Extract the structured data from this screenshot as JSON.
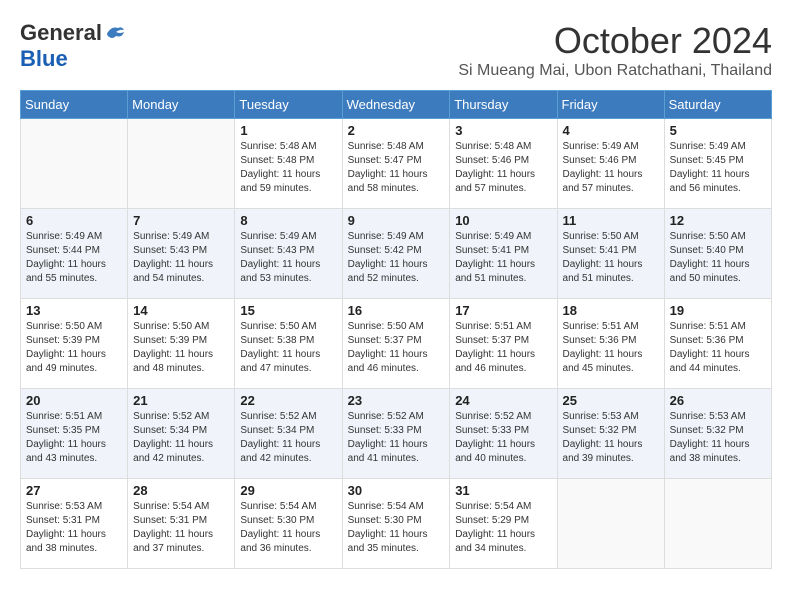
{
  "logo": {
    "line1": "General",
    "line2": "Blue",
    "bird_symbol": "🐦"
  },
  "title": {
    "month_year": "October 2024",
    "location": "Si Mueang Mai, Ubon Ratchathani, Thailand"
  },
  "weekdays": [
    "Sunday",
    "Monday",
    "Tuesday",
    "Wednesday",
    "Thursday",
    "Friday",
    "Saturday"
  ],
  "weeks": [
    [
      {
        "day": "",
        "info": ""
      },
      {
        "day": "",
        "info": ""
      },
      {
        "day": "1",
        "info": "Sunrise: 5:48 AM\nSunset: 5:48 PM\nDaylight: 11 hours and 59 minutes."
      },
      {
        "day": "2",
        "info": "Sunrise: 5:48 AM\nSunset: 5:47 PM\nDaylight: 11 hours and 58 minutes."
      },
      {
        "day": "3",
        "info": "Sunrise: 5:48 AM\nSunset: 5:46 PM\nDaylight: 11 hours and 57 minutes."
      },
      {
        "day": "4",
        "info": "Sunrise: 5:49 AM\nSunset: 5:46 PM\nDaylight: 11 hours and 57 minutes."
      },
      {
        "day": "5",
        "info": "Sunrise: 5:49 AM\nSunset: 5:45 PM\nDaylight: 11 hours and 56 minutes."
      }
    ],
    [
      {
        "day": "6",
        "info": "Sunrise: 5:49 AM\nSunset: 5:44 PM\nDaylight: 11 hours and 55 minutes."
      },
      {
        "day": "7",
        "info": "Sunrise: 5:49 AM\nSunset: 5:43 PM\nDaylight: 11 hours and 54 minutes."
      },
      {
        "day": "8",
        "info": "Sunrise: 5:49 AM\nSunset: 5:43 PM\nDaylight: 11 hours and 53 minutes."
      },
      {
        "day": "9",
        "info": "Sunrise: 5:49 AM\nSunset: 5:42 PM\nDaylight: 11 hours and 52 minutes."
      },
      {
        "day": "10",
        "info": "Sunrise: 5:49 AM\nSunset: 5:41 PM\nDaylight: 11 hours and 51 minutes."
      },
      {
        "day": "11",
        "info": "Sunrise: 5:50 AM\nSunset: 5:41 PM\nDaylight: 11 hours and 51 minutes."
      },
      {
        "day": "12",
        "info": "Sunrise: 5:50 AM\nSunset: 5:40 PM\nDaylight: 11 hours and 50 minutes."
      }
    ],
    [
      {
        "day": "13",
        "info": "Sunrise: 5:50 AM\nSunset: 5:39 PM\nDaylight: 11 hours and 49 minutes."
      },
      {
        "day": "14",
        "info": "Sunrise: 5:50 AM\nSunset: 5:39 PM\nDaylight: 11 hours and 48 minutes."
      },
      {
        "day": "15",
        "info": "Sunrise: 5:50 AM\nSunset: 5:38 PM\nDaylight: 11 hours and 47 minutes."
      },
      {
        "day": "16",
        "info": "Sunrise: 5:50 AM\nSunset: 5:37 PM\nDaylight: 11 hours and 46 minutes."
      },
      {
        "day": "17",
        "info": "Sunrise: 5:51 AM\nSunset: 5:37 PM\nDaylight: 11 hours and 46 minutes."
      },
      {
        "day": "18",
        "info": "Sunrise: 5:51 AM\nSunset: 5:36 PM\nDaylight: 11 hours and 45 minutes."
      },
      {
        "day": "19",
        "info": "Sunrise: 5:51 AM\nSunset: 5:36 PM\nDaylight: 11 hours and 44 minutes."
      }
    ],
    [
      {
        "day": "20",
        "info": "Sunrise: 5:51 AM\nSunset: 5:35 PM\nDaylight: 11 hours and 43 minutes."
      },
      {
        "day": "21",
        "info": "Sunrise: 5:52 AM\nSunset: 5:34 PM\nDaylight: 11 hours and 42 minutes."
      },
      {
        "day": "22",
        "info": "Sunrise: 5:52 AM\nSunset: 5:34 PM\nDaylight: 11 hours and 42 minutes."
      },
      {
        "day": "23",
        "info": "Sunrise: 5:52 AM\nSunset: 5:33 PM\nDaylight: 11 hours and 41 minutes."
      },
      {
        "day": "24",
        "info": "Sunrise: 5:52 AM\nSunset: 5:33 PM\nDaylight: 11 hours and 40 minutes."
      },
      {
        "day": "25",
        "info": "Sunrise: 5:53 AM\nSunset: 5:32 PM\nDaylight: 11 hours and 39 minutes."
      },
      {
        "day": "26",
        "info": "Sunrise: 5:53 AM\nSunset: 5:32 PM\nDaylight: 11 hours and 38 minutes."
      }
    ],
    [
      {
        "day": "27",
        "info": "Sunrise: 5:53 AM\nSunset: 5:31 PM\nDaylight: 11 hours and 38 minutes."
      },
      {
        "day": "28",
        "info": "Sunrise: 5:54 AM\nSunset: 5:31 PM\nDaylight: 11 hours and 37 minutes."
      },
      {
        "day": "29",
        "info": "Sunrise: 5:54 AM\nSunset: 5:30 PM\nDaylight: 11 hours and 36 minutes."
      },
      {
        "day": "30",
        "info": "Sunrise: 5:54 AM\nSunset: 5:30 PM\nDaylight: 11 hours and 35 minutes."
      },
      {
        "day": "31",
        "info": "Sunrise: 5:54 AM\nSunset: 5:29 PM\nDaylight: 11 hours and 34 minutes."
      },
      {
        "day": "",
        "info": ""
      },
      {
        "day": "",
        "info": ""
      }
    ]
  ]
}
